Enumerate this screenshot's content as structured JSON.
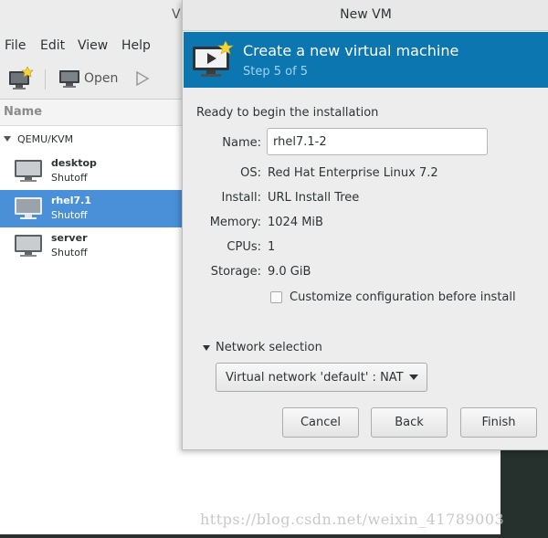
{
  "manager": {
    "title_fragment": "V",
    "menu": [
      "File",
      "Edit",
      "View",
      "Help"
    ],
    "toolbar": {
      "open_label": "Open"
    },
    "column_header": "Name",
    "connection": "QEMU/KVM",
    "vms": [
      {
        "name": "desktop",
        "status": "Shutoff",
        "selected": false
      },
      {
        "name": "rhel7.1",
        "status": "Shutoff",
        "selected": true
      },
      {
        "name": "server",
        "status": "Shutoff",
        "selected": false
      }
    ]
  },
  "dialog": {
    "title": "New VM",
    "banner": {
      "heading": "Create a new virtual machine",
      "step": "Step 5 of 5"
    },
    "ready_text": "Ready to begin the installation",
    "fields": {
      "name_label": "Name:",
      "name_value": "rhel7.1-2",
      "os_label": "OS:",
      "os_value": "Red Hat Enterprise Linux 7.2",
      "install_label": "Install:",
      "install_value": "URL Install Tree",
      "memory_label": "Memory:",
      "memory_value": "1024 MiB",
      "cpus_label": "CPUs:",
      "cpus_value": "1",
      "storage_label": "Storage:",
      "storage_value": "9.0 GiB"
    },
    "customize_label": "Customize configuration before install",
    "customize_checked": false,
    "network_label": "Network selection",
    "network_value": "Virtual network 'default' : NAT",
    "buttons": {
      "cancel": "Cancel",
      "back": "Back",
      "finish": "Finish"
    }
  },
  "watermark": "https://blog.csdn.net/weixin_41789003",
  "colors": {
    "banner": "#0b76b0",
    "selection": "#4a90d9",
    "step_text": "#9fd3f2"
  }
}
